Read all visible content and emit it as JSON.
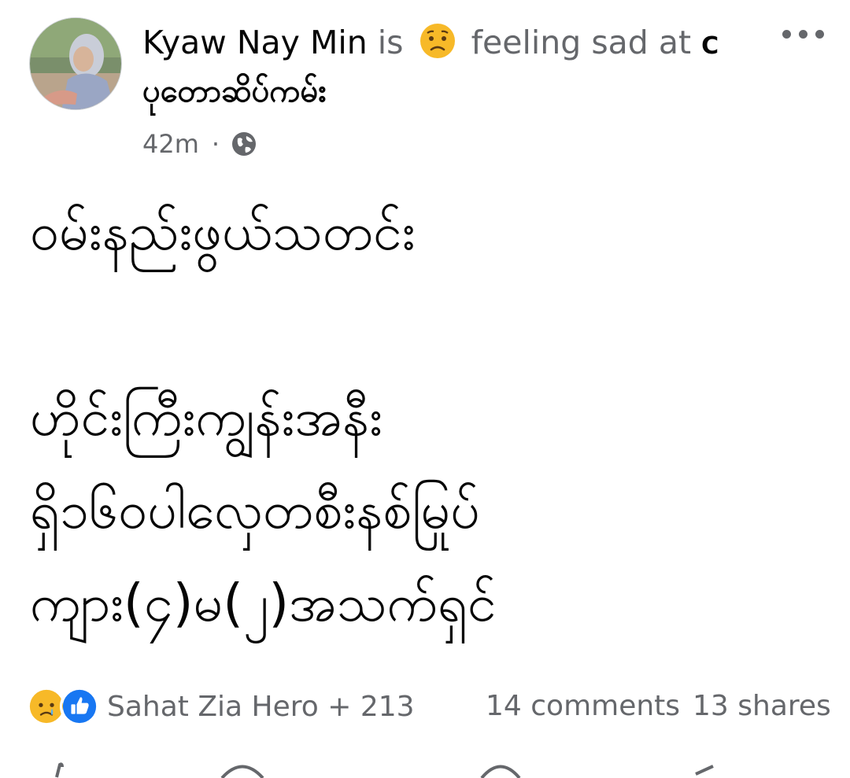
{
  "post": {
    "author": "Kyaw Nay Min",
    "is_text": "is",
    "feeling_text": "feeling sad at",
    "feeling_icon": "sad-face-emoji",
    "location_initial": "C",
    "location": "ပုတောဆိပ်ကမ်း",
    "time": "42m",
    "separator": "·",
    "audience_icon": "globe-icon",
    "more_icon": "more-options-icon",
    "body_lines": [
      "ဝမ်းနည်းဖွယ်သတင်း",
      "",
      "ဟိုင်းကြီးကျွန်းအနီး",
      "ရှိ၁၆ဝပါလှေတစီးနစ်မြုပ်",
      "ကျား(၄)မ(၂)အသက်ရှင်"
    ]
  },
  "footer": {
    "reaction_icons": [
      "sad-reaction-icon",
      "like-reaction-icon"
    ],
    "reactions_label": "Sahat Zia Hero + 213",
    "comments": "14 comments",
    "shares": "13 shares"
  },
  "colors": {
    "text": "#050505",
    "muted": "#65676b",
    "like_blue": "#1877f2",
    "sad_yellow": "#f7b928"
  }
}
